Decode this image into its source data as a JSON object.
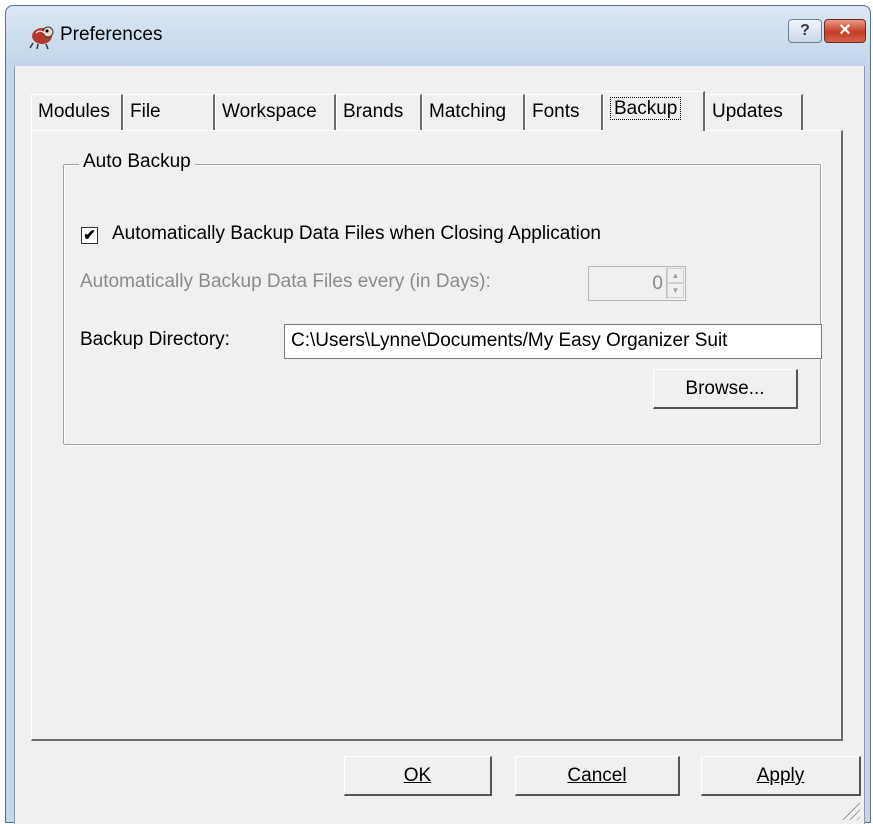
{
  "window": {
    "title": "Preferences",
    "help_label": "?",
    "close_label": "✕"
  },
  "tabs": [
    {
      "label": "Modules"
    },
    {
      "label": "File"
    },
    {
      "label": "Workspace"
    },
    {
      "label": "Brands"
    },
    {
      "label": "Matching"
    },
    {
      "label": "Fonts"
    },
    {
      "label": "Backup",
      "active": true
    },
    {
      "label": "Updates"
    }
  ],
  "backup": {
    "group_title": "Auto Backup",
    "auto_close_label": "Automatically Backup Data Files when Closing Application",
    "auto_close_checked": true,
    "every_days_label": "Automatically Backup Data Files every (in Days):",
    "every_days_value": "0",
    "directory_label": "Backup Directory:",
    "directory_value": "C:\\Users\\Lynne\\Documents/My Easy Organizer Suit",
    "browse_label": "Browse..."
  },
  "buttons": {
    "ok": "OK",
    "cancel": "Cancel",
    "apply": "Apply"
  }
}
